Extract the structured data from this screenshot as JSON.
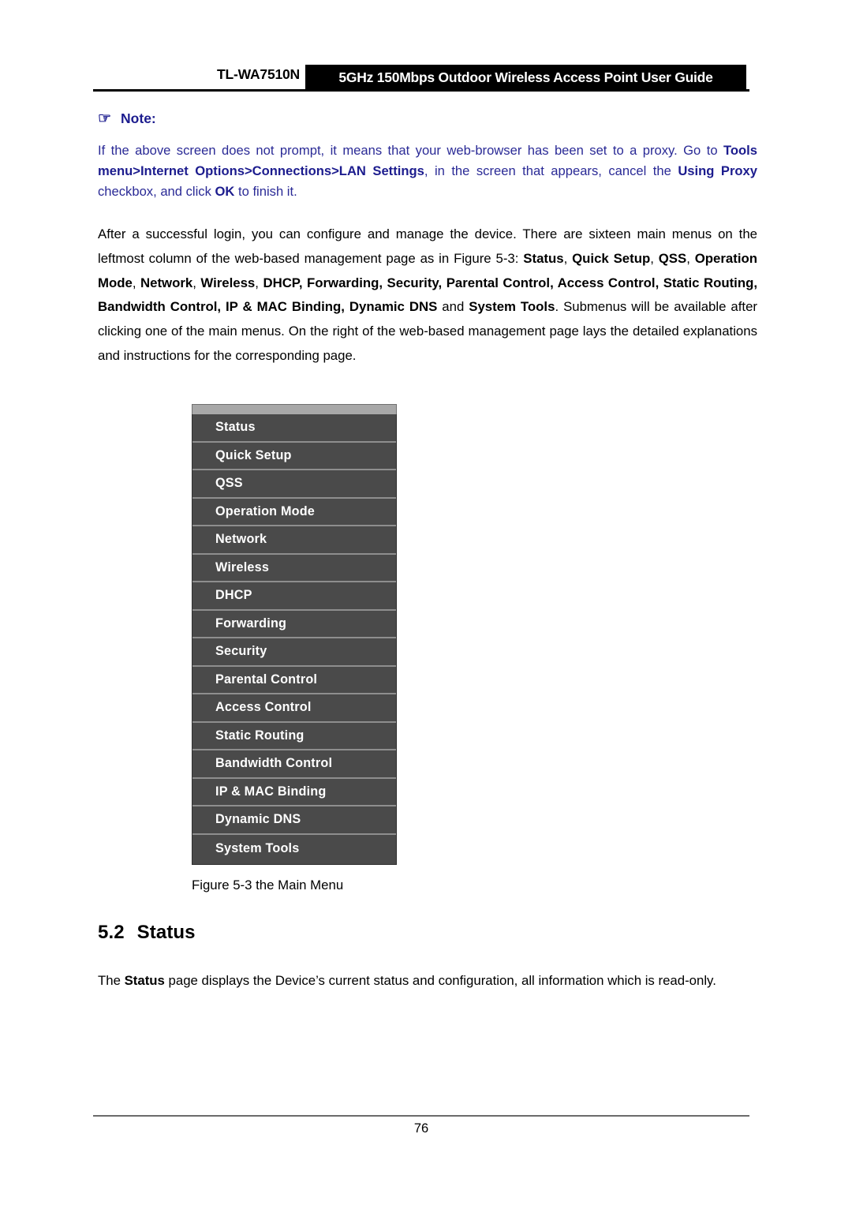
{
  "header": {
    "model": "TL-WA7510N",
    "title": "5GHz 150Mbps Outdoor Wireless Access Point User Guide"
  },
  "note": {
    "icon": "pointing-hand-icon",
    "icon_glyph": "☞",
    "label": "Note:",
    "text_parts": [
      {
        "text": "If the above screen does not prompt, it means that your web-browser has been set to a proxy. Go to ",
        "bold": false
      },
      {
        "text": "Tools menu>Internet Options>Connections>LAN Settings",
        "bold": true
      },
      {
        "text": ", in the screen that appears, cancel the ",
        "bold": false
      },
      {
        "text": "Using Proxy",
        "bold": true
      },
      {
        "text": " checkbox, and click ",
        "bold": false
      },
      {
        "text": "OK",
        "bold": true
      },
      {
        "text": " to finish it.",
        "bold": false
      }
    ],
    "color": "#1c1c8e"
  },
  "main_paragraph": {
    "parts": [
      {
        "text": "After a successful login, you can configure and manage the device. There are sixteen main menus on the leftmost column of the web-based management page as in Figure 5-3: ",
        "bold": false
      },
      {
        "text": "Status",
        "bold": true
      },
      {
        "text": ", ",
        "bold": false
      },
      {
        "text": "Quick Setup",
        "bold": true
      },
      {
        "text": ", ",
        "bold": false
      },
      {
        "text": "QSS",
        "bold": true
      },
      {
        "text": ", ",
        "bold": false
      },
      {
        "text": "Operation Mode",
        "bold": true
      },
      {
        "text": ", ",
        "bold": false
      },
      {
        "text": "Network",
        "bold": true
      },
      {
        "text": ", ",
        "bold": false
      },
      {
        "text": "Wireless",
        "bold": true
      },
      {
        "text": ", ",
        "bold": false
      },
      {
        "text": "DHCP, Forwarding, Security, Parental Control, Access Control, Static Routing, Bandwidth Control, IP & MAC Binding, Dynamic DNS",
        "bold": true
      },
      {
        "text": " and ",
        "bold": false
      },
      {
        "text": "System Tools",
        "bold": true
      },
      {
        "text": ". Submenus will be available after clicking one of the main menus. On the right of the web-based management page lays the detailed explanations and instructions for the corresponding page.",
        "bold": false
      }
    ]
  },
  "menu": {
    "background_color": "#4a4a4a",
    "divider_color": "#8e8e8e",
    "topbar_color": "#a8a8a8",
    "text_color": "#ffffff",
    "items": [
      {
        "label": "Status"
      },
      {
        "label": "Quick Setup"
      },
      {
        "label": "QSS"
      },
      {
        "label": "Operation Mode"
      },
      {
        "label": "Network"
      },
      {
        "label": "Wireless"
      },
      {
        "label": "DHCP"
      },
      {
        "label": "Forwarding"
      },
      {
        "label": "Security"
      },
      {
        "label": "Parental Control"
      },
      {
        "label": "Access Control"
      },
      {
        "label": "Static Routing"
      },
      {
        "label": "Bandwidth Control"
      },
      {
        "label": "IP & MAC Binding"
      },
      {
        "label": "Dynamic DNS"
      },
      {
        "label": "System Tools"
      }
    ]
  },
  "figure_caption": "Figure 5-3 the Main Menu",
  "section": {
    "number": "5.2",
    "title": "Status"
  },
  "status_paragraph": {
    "parts": [
      {
        "text": "The ",
        "bold": false
      },
      {
        "text": "Status",
        "bold": true
      },
      {
        "text": " page displays the Device’s current status and configuration, all information which is read-only.",
        "bold": false
      }
    ]
  },
  "footer": {
    "page_number": "76"
  }
}
